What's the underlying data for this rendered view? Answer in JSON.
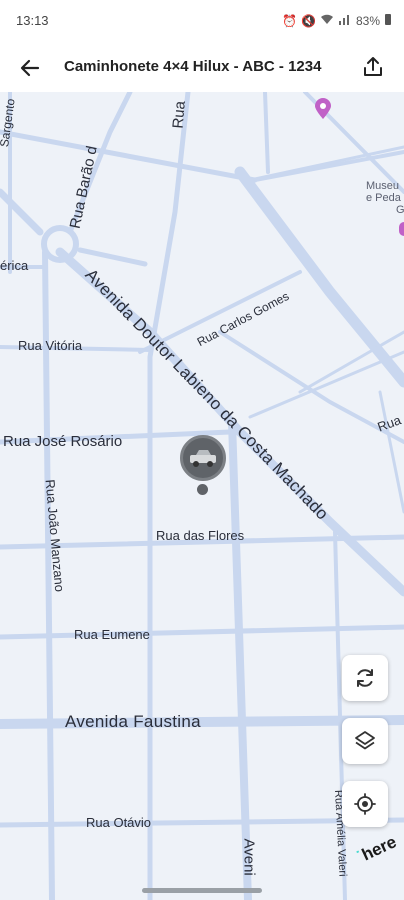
{
  "status_bar": {
    "time": "13:13",
    "battery": "83%"
  },
  "app_bar": {
    "title": "Caminhonete 4×4 Hilux - ABC - 1234"
  },
  "map": {
    "streets": {
      "barao": "Rua Barão d",
      "ru": "Rua",
      "sargento": "Sargento",
      "merica": "érica",
      "labieno": "Avenida Doutor Labieno da Costa Machado",
      "carlos_gomes": "Rua Carlos Gomes",
      "vitoria": "Rua Vitória",
      "jose_rosario": "Rua José Rosário",
      "ru_right": "Rua",
      "joao_manzano": "Rua João Manzano",
      "flores": "Rua das Flores",
      "eumene": "Rua Eumene",
      "faustina": "Avenida Faustina",
      "otavio": "Rua Otávio",
      "aveni": "Aveni",
      "valeri": "Rua Amélia Valeri"
    },
    "poi": {
      "museu_line1": "Museu",
      "museu_line2": "e Peda",
      "museu_line3": "G"
    }
  },
  "controls": {
    "refresh": "refresh-icon",
    "layers": "layers-icon",
    "locate": "locate-icon"
  },
  "branding": {
    "logo": "here"
  },
  "colors": {
    "map_bg": "#eef2f8",
    "road": "#c7d6f0",
    "major_road": "#c0d0ec",
    "marker": "#5f6368",
    "poi": "#c061c7"
  }
}
